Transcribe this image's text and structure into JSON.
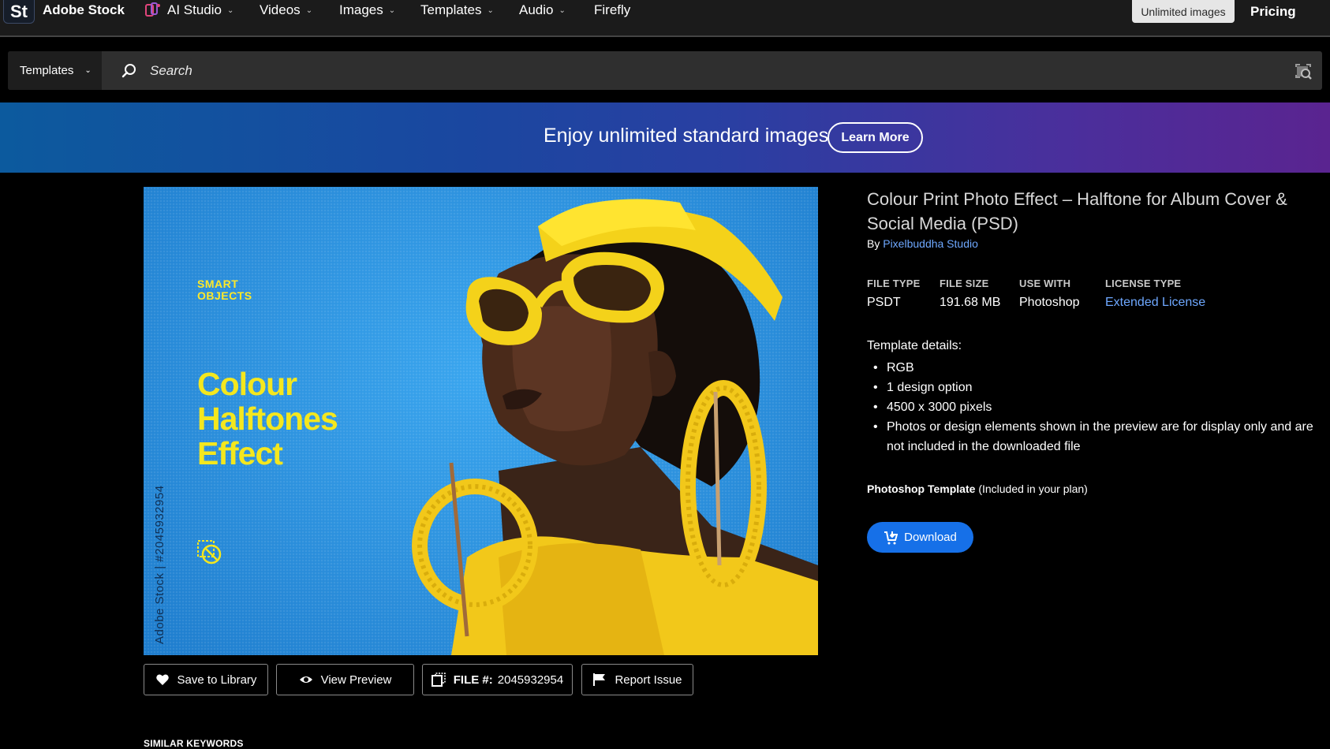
{
  "topnav": {
    "logo": "St",
    "brand": "Adobe Stock",
    "items": [
      {
        "label": "AI Studio",
        "icon": "ai-studio-icon"
      },
      {
        "label": "Videos"
      },
      {
        "label": "Images"
      },
      {
        "label": "Templates"
      },
      {
        "label": "Audio"
      },
      {
        "label": "Firefly"
      }
    ],
    "unlimited_label": "Unlimited images",
    "pricing_label": "Pricing"
  },
  "search": {
    "category": "Templates",
    "placeholder": "Search",
    "icon": "search-icon",
    "visual_search_icon": "visual-search-icon"
  },
  "banner": {
    "text": "Enjoy unlimited standard images",
    "button": "Learn More"
  },
  "preview": {
    "smart_line1": "SMART",
    "smart_line2": "OBJECTS",
    "title_line1": "Colour",
    "title_line2": "Halftones",
    "title_line3": "Effect",
    "vertical_text": "Adobe Stock | #2045932954"
  },
  "actions": {
    "save": "Save to Library",
    "view": "View Preview",
    "file_label": "FILE #:",
    "file_number": "2045932954",
    "report": "Report Issue"
  },
  "similar_keywords": "SIMILAR KEYWORDS",
  "asset": {
    "title": "Colour Print Photo Effect – Halftone for Album Cover & Social Media (PSD)",
    "by": "By",
    "author": "Pixelbuddha Studio",
    "meta": [
      {
        "label": "FILE TYPE",
        "value": "PSDT"
      },
      {
        "label": "FILE SIZE",
        "value": "191.68 MB"
      },
      {
        "label": "USE WITH",
        "value": "Photoshop"
      },
      {
        "label": "LICENSE TYPE",
        "value": "Extended License"
      }
    ],
    "details_head": "Template details:",
    "details": [
      "RGB",
      "1 design option",
      "4500 x 3000 pixels",
      "Photos or design elements shown in the preview are for display only and are not included in the downloaded file"
    ],
    "plan_bold": "Photoshop Template",
    "plan_note": "(Included in your plan)",
    "download": "Download"
  },
  "colors": {
    "accent_blue": "#1670e8",
    "link_blue": "#6ea8ff",
    "banner_start": "#0c5a9e",
    "banner_end": "#5a2490",
    "preview_yellow": "#f4e71e"
  }
}
